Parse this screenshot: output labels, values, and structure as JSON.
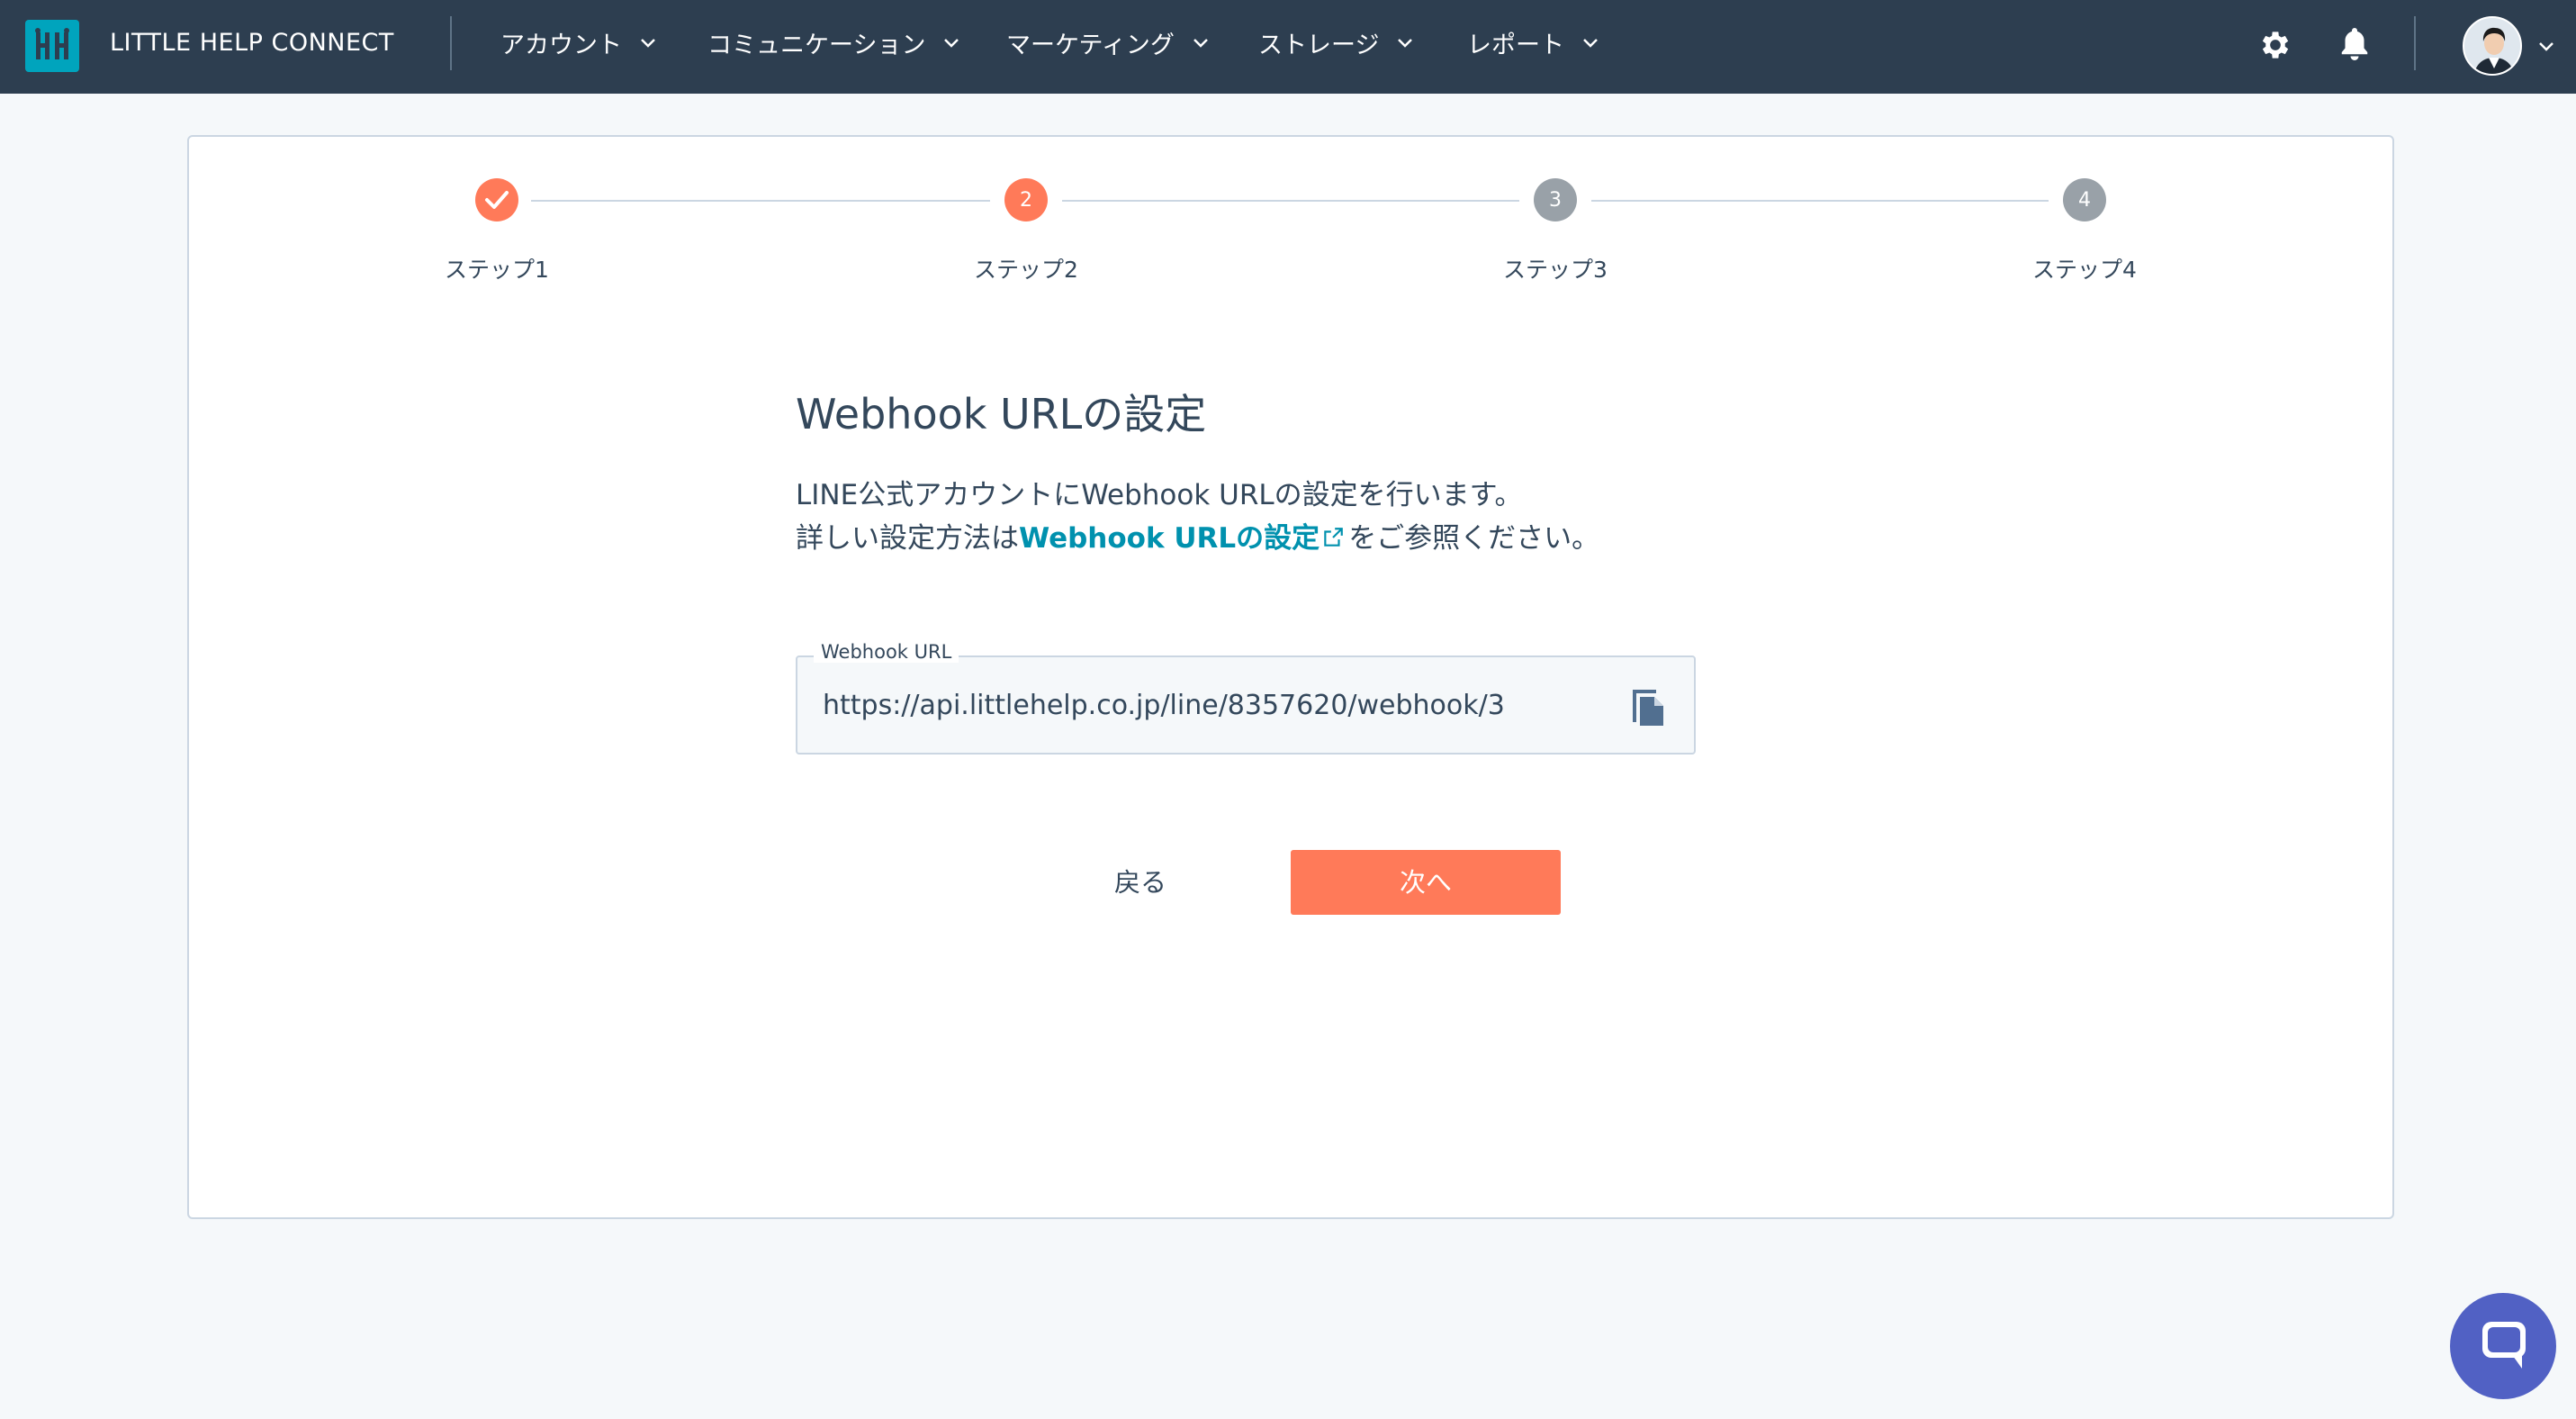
{
  "app": {
    "brand": "LITTLE HELP CONNECT"
  },
  "nav": {
    "items": [
      {
        "label": "アカウント"
      },
      {
        "label": "コミュニケーション"
      },
      {
        "label": "マーケティング"
      },
      {
        "label": "ストレージ"
      },
      {
        "label": "レポート"
      }
    ],
    "icons": [
      "settings-icon",
      "bell-icon",
      "avatar"
    ]
  },
  "stepper": {
    "steps": [
      {
        "label": "ステップ1",
        "number": "1",
        "status": "completed"
      },
      {
        "label": "ステップ2",
        "number": "2",
        "status": "current"
      },
      {
        "label": "ステップ3",
        "number": "3",
        "status": "pending"
      },
      {
        "label": "ステップ4",
        "number": "4",
        "status": "pending"
      }
    ]
  },
  "main": {
    "title": "Webhook URLの設定",
    "description_line1": "LINE公式アカウントにWebhook URLの設定を行います。",
    "description_line2_prefix": "詳しい設定方法は",
    "description_link": "Webhook URLの設定",
    "description_line2_suffix": "をご参照ください。",
    "field": {
      "label": "Webhook URL",
      "value": "https://api.littlehelp.co.jp/line/8357620/webhook/3"
    },
    "back_label": "戻る",
    "next_label": "次へ"
  },
  "colors": {
    "topbar": "#2d3e50",
    "accent": "#ff7a59",
    "link": "#0091ae",
    "pending": "#99a1a8",
    "chat": "#5161c4"
  }
}
